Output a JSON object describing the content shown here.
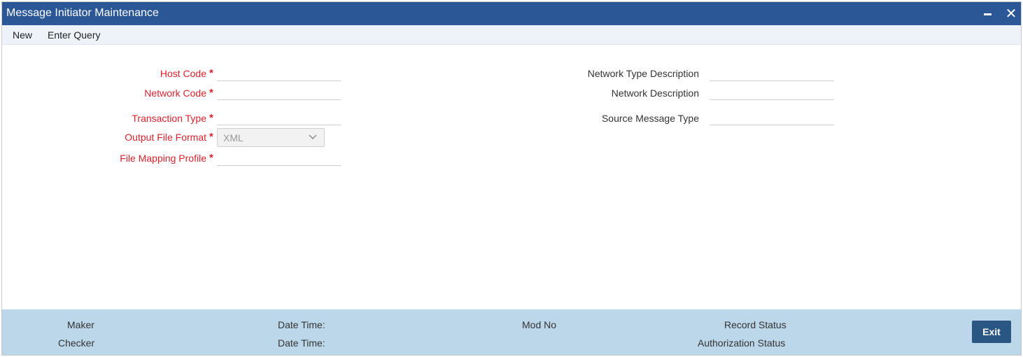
{
  "window": {
    "title": "Message Initiator Maintenance"
  },
  "toolbar": {
    "new_label": "New",
    "enter_query_label": "Enter Query"
  },
  "form": {
    "host_code": {
      "label": "Host Code",
      "value": ""
    },
    "network_code": {
      "label": "Network Code",
      "value": ""
    },
    "transaction_type": {
      "label": "Transaction Type",
      "value": ""
    },
    "output_file_format": {
      "label": "Output File Format",
      "value": "XML"
    },
    "file_mapping_profile": {
      "label": "File Mapping Profile",
      "value": ""
    },
    "network_type_description": {
      "label": "Network Type Description",
      "value": ""
    },
    "network_description": {
      "label": "Network Description",
      "value": ""
    },
    "source_message_type": {
      "label": "Source Message Type",
      "value": ""
    },
    "required_marker": "*"
  },
  "footer": {
    "maker": "Maker",
    "checker": "Checker",
    "date_time_1": "Date Time:",
    "date_time_2": "Date Time:",
    "mod_no": "Mod No",
    "record_status": "Record Status",
    "authorization_status": "Authorization Status",
    "exit_label": "Exit"
  },
  "colors": {
    "titlebar": "#2b5797",
    "required": "#d9212c",
    "footer": "#bcd7ea",
    "exit_button": "#2a5683"
  },
  "icons": {
    "minimize": "minimize-icon",
    "close": "close-icon",
    "dropdown": "chevron-down-icon"
  }
}
